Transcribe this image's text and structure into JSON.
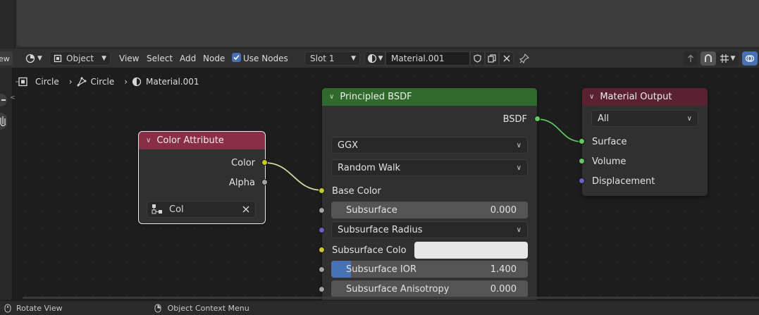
{
  "header": {
    "partial_left": "ew",
    "object_mode": "Object",
    "menus": [
      "View",
      "Select",
      "Add",
      "Node"
    ],
    "use_nodes_label": "Use Nodes",
    "use_nodes_checked": true,
    "slot": "Slot 1",
    "material_name": "Material.001"
  },
  "breadcrumb": {
    "object": "Circle",
    "mesh": "Circle",
    "material": "Material.001"
  },
  "color_attribute_node": {
    "title": "Color Attribute",
    "outputs": [
      "Color",
      "Alpha"
    ],
    "layer_name": "Col"
  },
  "principled_node": {
    "title": "Principled BSDF",
    "output": "BSDF",
    "distribution": "GGX",
    "subsurface_method": "Random Walk",
    "inputs": {
      "base_color": "Base Color",
      "subsurface_label": "Subsurface",
      "subsurface_value": "0.000",
      "subsurface_radius": "Subsurface Radius",
      "subsurface_color": "Subsurface Colo",
      "subsurface_ior_label": "Subsurface IOR",
      "subsurface_ior_value": "1.400",
      "subsurface_ior_fill": 0.1,
      "subsurface_aniso_label": "Subsurface Anisotropy",
      "subsurface_aniso_value": "0.000"
    }
  },
  "output_node": {
    "title": "Material Output",
    "target": "All",
    "inputs": [
      "Surface",
      "Volume",
      "Displacement"
    ]
  },
  "statusbar": {
    "left": "Rotate View",
    "right": "Object Context Menu"
  },
  "colors": {
    "attribute_header": "#8a2e48",
    "shader_header": "#2f6a2c",
    "output_header": "#5a2230",
    "socket_yellow": "#c7c729",
    "socket_gray": "#a1a1a1",
    "socket_green": "#63c763",
    "socket_purple": "#6363c7",
    "accent_blue": "#4772b3"
  }
}
